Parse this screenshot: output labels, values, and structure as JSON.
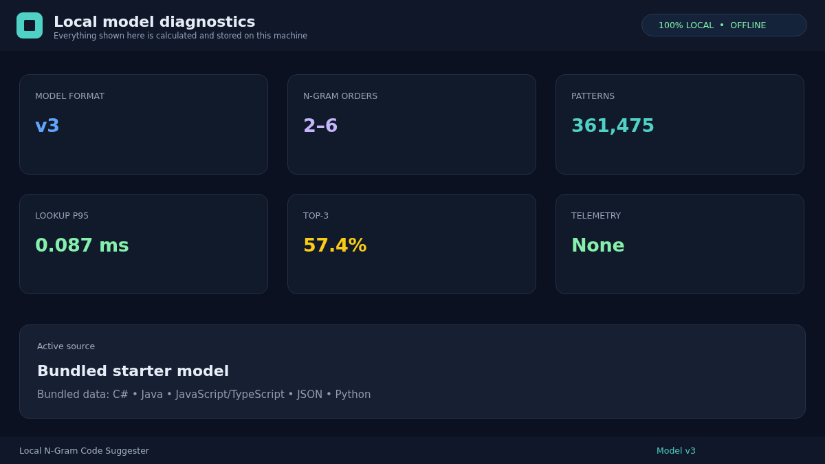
{
  "header": {
    "title": "Local model diagnostics",
    "subtitle": "Everything shown here is calculated and stored on this machine",
    "badge": {
      "items": [
        "100% LOCAL",
        "OFFLINE"
      ]
    }
  },
  "metrics": [
    {
      "label": "MODEL FORMAT",
      "value": "v3",
      "color": "#60a5fa"
    },
    {
      "label": "N-GRAM ORDERS",
      "value": "2–6",
      "color": "#c4b5fd"
    },
    {
      "label": "PATTERNS",
      "value": "361,475",
      "color": "#4fd1c5"
    },
    {
      "label": "LOOKUP P95",
      "value": "0.087 ms",
      "color": "#86efac"
    },
    {
      "label": "TOP-3",
      "value": "57.4%",
      "color": "#facc15"
    },
    {
      "label": "TELEMETRY",
      "value": "None",
      "color": "#86efac"
    }
  ],
  "source": {
    "label": "Active source",
    "title": "Bundled starter model",
    "detail": "Bundled data: C# • Java • JavaScript/TypeScript • JSON • Python"
  },
  "status_bar": {
    "app_name": "Local N-Gram Code Suggester",
    "model": "Model v3"
  }
}
